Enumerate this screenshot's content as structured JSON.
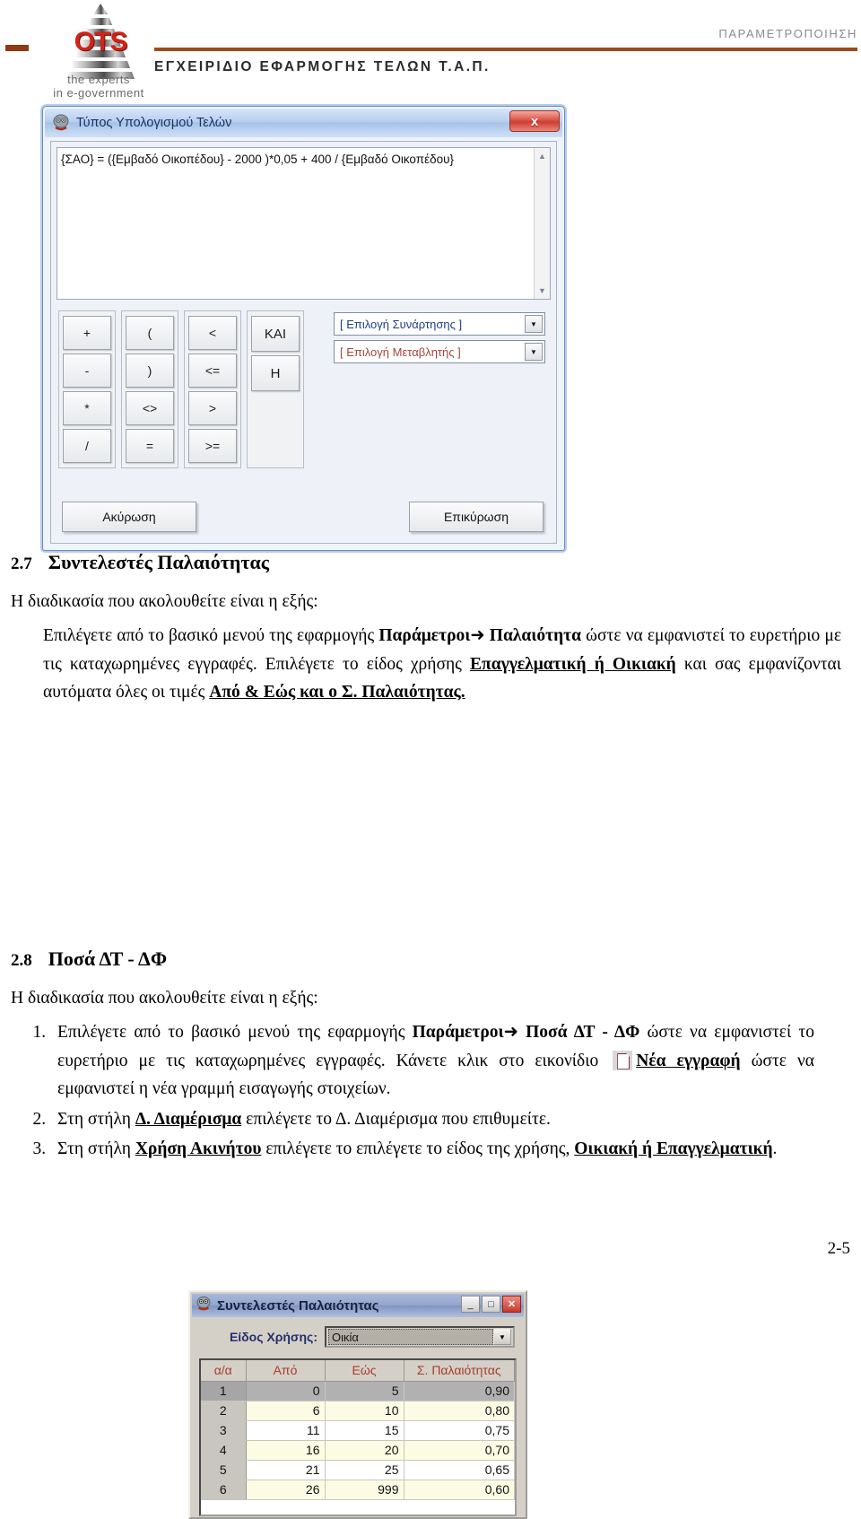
{
  "header": {
    "logo_text": "OTS",
    "logo_tagline1": "the experts",
    "logo_tagline2": "in e-government",
    "section_label": "ΠΑΡΑΜΕΤΡΟΠΟΙΗΣΗ",
    "manual_title": "ΕΓΧΕΙΡΙΔΙΟ ΕΦΑΡΜΟΓΗΣ ΤΕΛΩΝ Τ.Α.Π."
  },
  "dialog_formula": {
    "title": "Τύπος Υπολογισμού Τελών",
    "close_label": "x",
    "expression": "{ΣΑΟ} = ({Εμβαδό Οικοπέδου} - 2000 )*0,05 + 400 / {Εμβαδό Οικοπέδου}",
    "keypad": {
      "col_arith": [
        "+",
        "-",
        "*",
        "/"
      ],
      "col_paren": [
        "(",
        ")",
        "<>",
        "="
      ],
      "col_compare": [
        "<",
        "<=",
        ">",
        ">="
      ],
      "col_logic": [
        "ΚΑΙ",
        "Η"
      ]
    },
    "combo_function": "[ Επιλογή Συνάρτησης ]",
    "combo_variable": "[ Επιλογή Μεταβλητής ]",
    "combo_function_color": "#1f3f86",
    "combo_variable_color": "#a4463a",
    "cancel_label": "Ακύρωση",
    "confirm_label": "Επικύρωση"
  },
  "section_27": {
    "number": "2.7",
    "title": "Συντελεστές Παλαιότητας",
    "intro": "Η διαδικασία που ακολουθείτε είναι η εξής:",
    "p1_a": "Επιλέγετε από το βασικό μενού της εφαρμογής ",
    "p1_b1": "Παράμετροι",
    "p1_arrow": "➜",
    "p1_b2": "Παλαιότητα",
    "p1_c": " ώστε να εμφανιστεί το ευρετήριο με τις καταχωρημένες εγγραφές. Επιλέγετε το είδος χρήσης ",
    "p1_u1": "Επαγγελματική ή Οικιακή",
    "p1_d": " και σας εμφανίζονται αυτόματα όλες οι τιμές ",
    "p1_u2": "Από & Εώς και ο Σ. Παλαιότητας."
  },
  "dialog_coefficients": {
    "title": "Συντελεστές Παλαιότητας",
    "minimize_label": "_",
    "maximize_label": "□",
    "close_label": "✕",
    "use_type_label": "Είδος Χρήσης:",
    "use_type_value": "Οικία",
    "columns": [
      "α/α",
      "Από",
      "Εώς",
      "Σ. Παλαιότητας"
    ],
    "rows": [
      {
        "idx": "1",
        "from": "0",
        "to": "5",
        "coef": "0,90",
        "state": "selected"
      },
      {
        "idx": "2",
        "from": "6",
        "to": "10",
        "coef": "0,80",
        "state": "alt"
      },
      {
        "idx": "3",
        "from": "11",
        "to": "15",
        "coef": "0,75",
        "state": "norm"
      },
      {
        "idx": "4",
        "from": "16",
        "to": "20",
        "coef": "0,70",
        "state": "alt"
      },
      {
        "idx": "5",
        "from": "21",
        "to": "25",
        "coef": "0,65",
        "state": "norm"
      },
      {
        "idx": "6",
        "from": "26",
        "to": "999",
        "coef": "0,60",
        "state": "alt"
      }
    ]
  },
  "section_28": {
    "number": "2.8",
    "title": "Ποσά ΔΤ - ΔΦ",
    "intro": "Η διαδικασία που ακολουθείτε είναι η εξής:",
    "step1_a": "Επιλέγετε από το βασικό μενού της εφαρμογής ",
    "step1_b1": "Παράμετροι",
    "step1_arrow": "➜",
    "step1_b2": "Ποσά ΔΤ - ΔΦ",
    "step1_c": " ώστε να εμφανιστεί το ευρετήριο με τις καταχωρημένες εγγραφές. Κάνετε κλικ στο εικονίδιο ",
    "step1_icon": "new-document-icon",
    "step1_u1": "Νέα εγγραφή",
    "step1_d": " ώστε να εμφανιστεί η νέα γραμμή εισαγωγής στοιχείων.",
    "step2_a": "Στη στήλη ",
    "step2_u": "Δ. Διαμέρισμα",
    "step2_b": " επιλέγετε το Δ. Διαμέρισμα που επιθυμείτε.",
    "step3_a": "Στη στήλη ",
    "step3_u1": "Χρήση Ακινήτου",
    "step3_b": " επιλέγετε το επιλέγετε το είδος της χρήσης, ",
    "step3_u2": "Οικιακή ή Επαγγελματική",
    "step3_c": "."
  },
  "footer": {
    "page_number": "2-5"
  }
}
